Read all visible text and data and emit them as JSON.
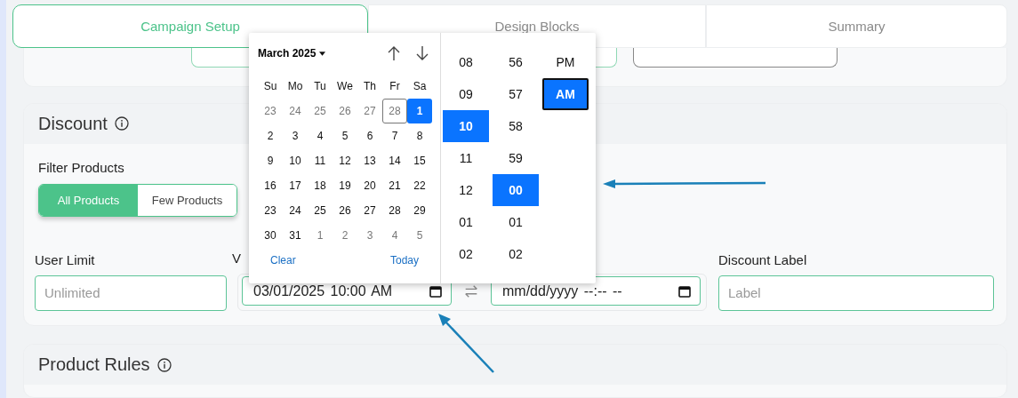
{
  "tabs": [
    {
      "label": "Campaign Setup",
      "selected": true
    },
    {
      "label": "Design Blocks",
      "selected": false
    },
    {
      "label": "Summary",
      "selected": false
    }
  ],
  "discount": {
    "title": "Discount",
    "filter_label": "Filter Products",
    "filter_options": [
      {
        "label": "All Products",
        "selected": true
      },
      {
        "label": "Few Products",
        "selected": false
      }
    ],
    "user_limit": {
      "label": "User Limit",
      "placeholder": "Unlimited"
    },
    "validity": {
      "label": "V",
      "start_value": "03/01/2025 10:00 AM",
      "end_value": "mm/dd/yyyy --:-- --"
    },
    "discount_label": {
      "label": "Discount Label",
      "placeholder": "Label"
    }
  },
  "product_rules": {
    "title": "Product Rules"
  },
  "datepicker": {
    "month": "March 2025",
    "weekdays": [
      "Su",
      "Mo",
      "Tu",
      "We",
      "Th",
      "Fr",
      "Sa"
    ],
    "days": [
      {
        "label": "23",
        "outside": true,
        "outlined": false,
        "selected": false
      },
      {
        "label": "24",
        "outside": true,
        "outlined": false,
        "selected": false
      },
      {
        "label": "25",
        "outside": true,
        "outlined": false,
        "selected": false
      },
      {
        "label": "26",
        "outside": true,
        "outlined": false,
        "selected": false
      },
      {
        "label": "27",
        "outside": true,
        "outlined": false,
        "selected": false
      },
      {
        "label": "28",
        "outside": true,
        "outlined": true,
        "selected": false
      },
      {
        "label": "1",
        "outside": false,
        "outlined": false,
        "selected": true
      },
      {
        "label": "2",
        "outside": false,
        "outlined": false,
        "selected": false
      },
      {
        "label": "3",
        "outside": false,
        "outlined": false,
        "selected": false
      },
      {
        "label": "4",
        "outside": false,
        "outlined": false,
        "selected": false
      },
      {
        "label": "5",
        "outside": false,
        "outlined": false,
        "selected": false
      },
      {
        "label": "6",
        "outside": false,
        "outlined": false,
        "selected": false
      },
      {
        "label": "7",
        "outside": false,
        "outlined": false,
        "selected": false
      },
      {
        "label": "8",
        "outside": false,
        "outlined": false,
        "selected": false
      },
      {
        "label": "9",
        "outside": false,
        "outlined": false,
        "selected": false
      },
      {
        "label": "10",
        "outside": false,
        "outlined": false,
        "selected": false
      },
      {
        "label": "11",
        "outside": false,
        "outlined": false,
        "selected": false
      },
      {
        "label": "12",
        "outside": false,
        "outlined": false,
        "selected": false
      },
      {
        "label": "13",
        "outside": false,
        "outlined": false,
        "selected": false
      },
      {
        "label": "14",
        "outside": false,
        "outlined": false,
        "selected": false
      },
      {
        "label": "15",
        "outside": false,
        "outlined": false,
        "selected": false
      },
      {
        "label": "16",
        "outside": false,
        "outlined": false,
        "selected": false
      },
      {
        "label": "17",
        "outside": false,
        "outlined": false,
        "selected": false
      },
      {
        "label": "18",
        "outside": false,
        "outlined": false,
        "selected": false
      },
      {
        "label": "19",
        "outside": false,
        "outlined": false,
        "selected": false
      },
      {
        "label": "20",
        "outside": false,
        "outlined": false,
        "selected": false
      },
      {
        "label": "21",
        "outside": false,
        "outlined": false,
        "selected": false
      },
      {
        "label": "22",
        "outside": false,
        "outlined": false,
        "selected": false
      },
      {
        "label": "23",
        "outside": false,
        "outlined": false,
        "selected": false
      },
      {
        "label": "24",
        "outside": false,
        "outlined": false,
        "selected": false
      },
      {
        "label": "25",
        "outside": false,
        "outlined": false,
        "selected": false
      },
      {
        "label": "26",
        "outside": false,
        "outlined": false,
        "selected": false
      },
      {
        "label": "27",
        "outside": false,
        "outlined": false,
        "selected": false
      },
      {
        "label": "28",
        "outside": false,
        "outlined": false,
        "selected": false
      },
      {
        "label": "29",
        "outside": false,
        "outlined": false,
        "selected": false
      },
      {
        "label": "30",
        "outside": false,
        "outlined": false,
        "selected": false
      },
      {
        "label": "31",
        "outside": false,
        "outlined": false,
        "selected": false
      },
      {
        "label": "1",
        "outside": true,
        "outlined": false,
        "selected": false
      },
      {
        "label": "2",
        "outside": true,
        "outlined": false,
        "selected": false
      },
      {
        "label": "3",
        "outside": true,
        "outlined": false,
        "selected": false
      },
      {
        "label": "4",
        "outside": true,
        "outlined": false,
        "selected": false
      },
      {
        "label": "5",
        "outside": true,
        "outlined": false,
        "selected": false
      }
    ],
    "clear": "Clear",
    "today": "Today",
    "hours": [
      {
        "label": "08",
        "selected": false
      },
      {
        "label": "09",
        "selected": false
      },
      {
        "label": "10",
        "selected": true
      },
      {
        "label": "11",
        "selected": false
      },
      {
        "label": "12",
        "selected": false
      },
      {
        "label": "01",
        "selected": false
      },
      {
        "label": "02",
        "selected": false
      }
    ],
    "minutes": [
      {
        "label": "56",
        "selected": false
      },
      {
        "label": "57",
        "selected": false
      },
      {
        "label": "58",
        "selected": false
      },
      {
        "label": "59",
        "selected": false
      },
      {
        "label": "00",
        "selected": true
      },
      {
        "label": "01",
        "selected": false
      },
      {
        "label": "02",
        "selected": false
      }
    ],
    "periods": [
      {
        "label": "PM",
        "selected": false
      },
      {
        "label": "AM",
        "selected": true
      }
    ]
  }
}
